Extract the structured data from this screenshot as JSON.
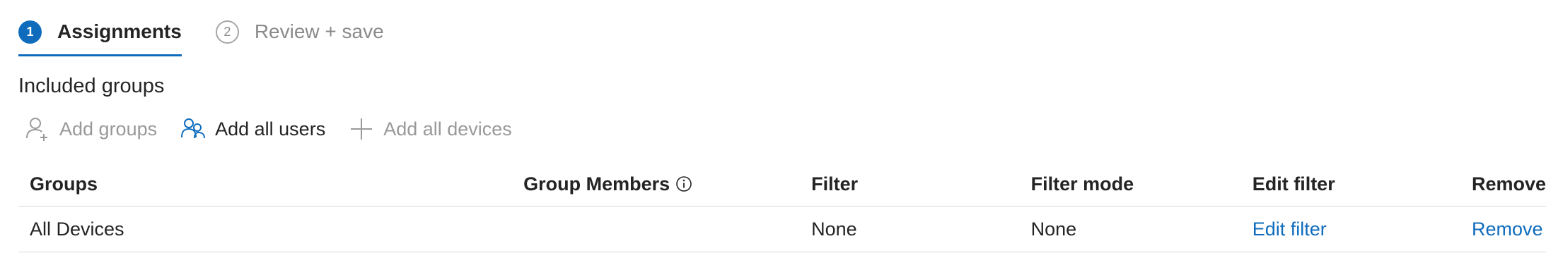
{
  "wizard": {
    "steps": [
      {
        "number": "1",
        "label": "Assignments",
        "state": "active"
      },
      {
        "number": "2",
        "label": "Review + save",
        "state": "inactive"
      }
    ]
  },
  "section": {
    "title": "Included groups"
  },
  "toolbar": {
    "add_groups": {
      "label": "Add groups",
      "icon": "add-person-icon",
      "enabled": false
    },
    "add_all_users": {
      "label": "Add all users",
      "icon": "people-icon",
      "enabled": true
    },
    "add_all_devices": {
      "label": "Add all devices",
      "icon": "plus-icon",
      "enabled": false
    }
  },
  "table": {
    "headers": {
      "groups": "Groups",
      "group_members": "Group Members",
      "filter": "Filter",
      "filter_mode": "Filter mode",
      "edit_filter": "Edit filter",
      "remove": "Remove"
    },
    "rows": [
      {
        "group": "All Devices",
        "group_members": "",
        "filter": "None",
        "filter_mode": "None",
        "edit_filter": "Edit filter",
        "remove": "Remove"
      }
    ]
  },
  "colors": {
    "accent": "#0f6cbd",
    "text": "#242424",
    "disabled": "#999999"
  }
}
